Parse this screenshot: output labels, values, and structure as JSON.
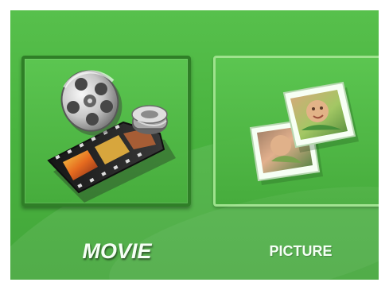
{
  "menu": {
    "items": [
      {
        "label": "MOVIE",
        "icon": "movie-reel-film-strip-icon",
        "selected": true
      },
      {
        "label": "PICTURE",
        "icon": "photo-stack-icon",
        "selected": false
      }
    ]
  },
  "colors": {
    "background": "#49b33f",
    "selected_border": "#2f7f27",
    "normal_border": "#9ee28d",
    "label_text": "#f5fff5"
  }
}
